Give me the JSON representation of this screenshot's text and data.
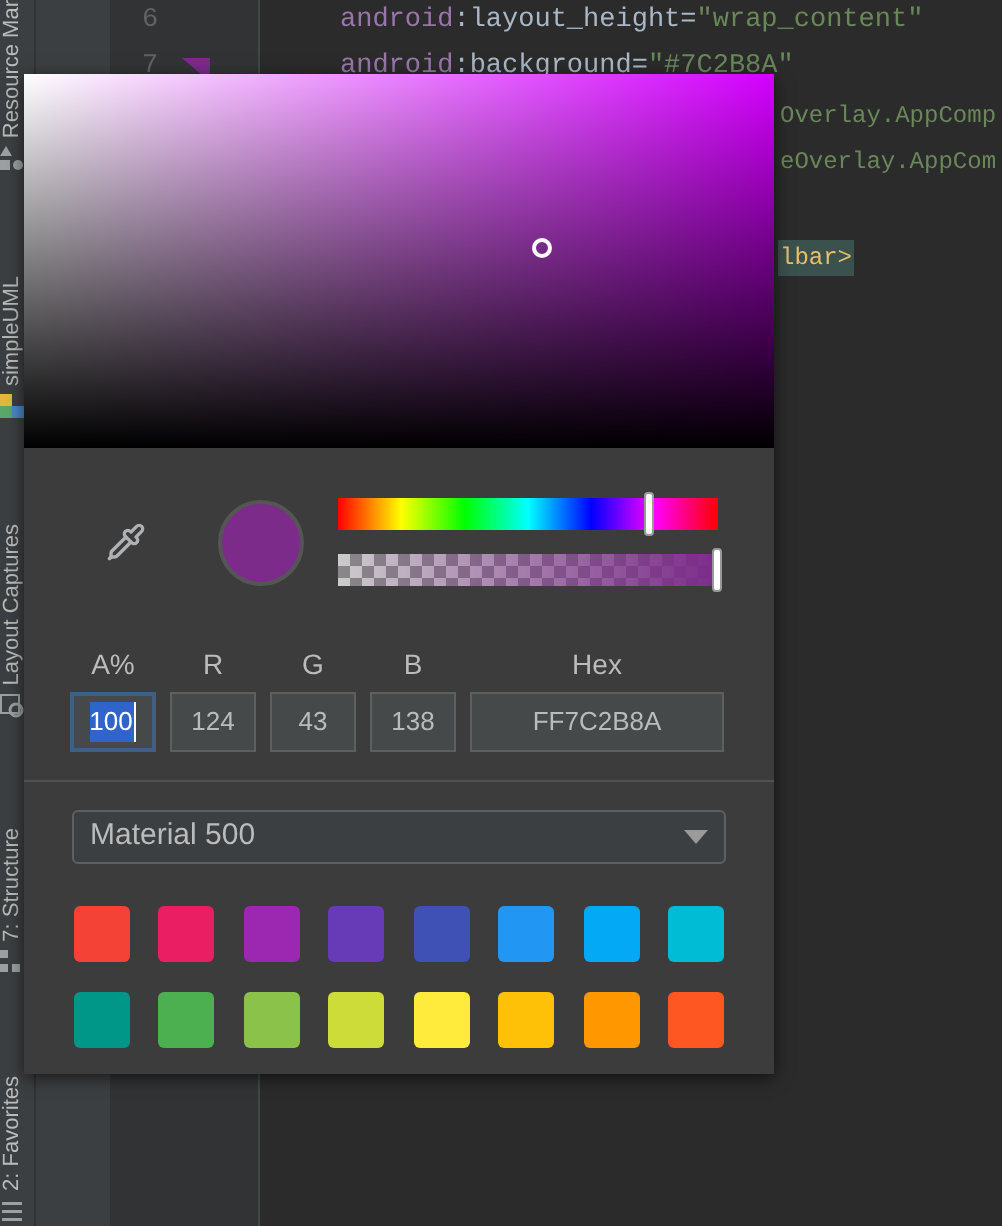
{
  "tool_strip": {
    "tabs": [
      {
        "label": "Resource Mar"
      },
      {
        "label": "simpleUML"
      },
      {
        "label": "Layout Captures"
      },
      {
        "label": "7: Structure"
      },
      {
        "label": "2: Favorites"
      }
    ]
  },
  "editor": {
    "numbered_lines": [
      {
        "number": "6",
        "gutter_color": false,
        "segments": [
          {
            "kind": "ns",
            "text": "android"
          },
          {
            "kind": "punct",
            "text": ":"
          },
          {
            "kind": "attr",
            "text": "layout_height"
          },
          {
            "kind": "punct",
            "text": "="
          },
          {
            "kind": "value",
            "text": "\"wrap_content\""
          }
        ]
      },
      {
        "number": "7",
        "gutter_color": true,
        "segments": [
          {
            "kind": "ns",
            "text": "android"
          },
          {
            "kind": "punct",
            "text": ":"
          },
          {
            "kind": "attr",
            "text": "background"
          },
          {
            "kind": "punct",
            "text": "="
          },
          {
            "kind": "value",
            "text": "\"#7C2B8A\""
          }
        ]
      }
    ],
    "partial_lines": [
      {
        "highlighted": false,
        "segments": [
          {
            "kind": "value",
            "text": "Overlay.AppComp"
          }
        ]
      },
      {
        "highlighted": false,
        "segments": [
          {
            "kind": "value",
            "text": "eOverlay.AppCom"
          }
        ]
      },
      {
        "highlighted": true,
        "segments": [
          {
            "kind": "tag",
            "text": "lbar>"
          }
        ]
      }
    ]
  },
  "color_picker": {
    "preview": {
      "color": "#7c2b8a"
    },
    "hue": {
      "level": 0.82
    },
    "alpha": {
      "level": 1
    },
    "fields": [
      {
        "label": "A%",
        "value": "100",
        "focused": true
      },
      {
        "label": "R",
        "value": "124",
        "focused": false
      },
      {
        "label": "G",
        "value": "43",
        "focused": false
      },
      {
        "label": "B",
        "value": "138",
        "focused": false
      },
      {
        "label": "Hex",
        "value": "FF7C2B8A",
        "focused": false
      }
    ],
    "palette": {
      "value": "Material 500"
    },
    "swatches": [
      {
        "color": "#f44336"
      },
      {
        "color": "#e91e63"
      },
      {
        "color": "#9c27b0"
      },
      {
        "color": "#673ab7"
      },
      {
        "color": "#3f51b5"
      },
      {
        "color": "#2196f3"
      },
      {
        "color": "#03a9f4"
      },
      {
        "color": "#00bcd4"
      },
      {
        "color": "#009688"
      },
      {
        "color": "#4caf50"
      },
      {
        "color": "#8bc34a"
      },
      {
        "color": "#cddc39"
      },
      {
        "color": "#ffeb3b"
      },
      {
        "color": "#ffc107"
      },
      {
        "color": "#ff9800"
      },
      {
        "color": "#ff5722"
      }
    ]
  }
}
